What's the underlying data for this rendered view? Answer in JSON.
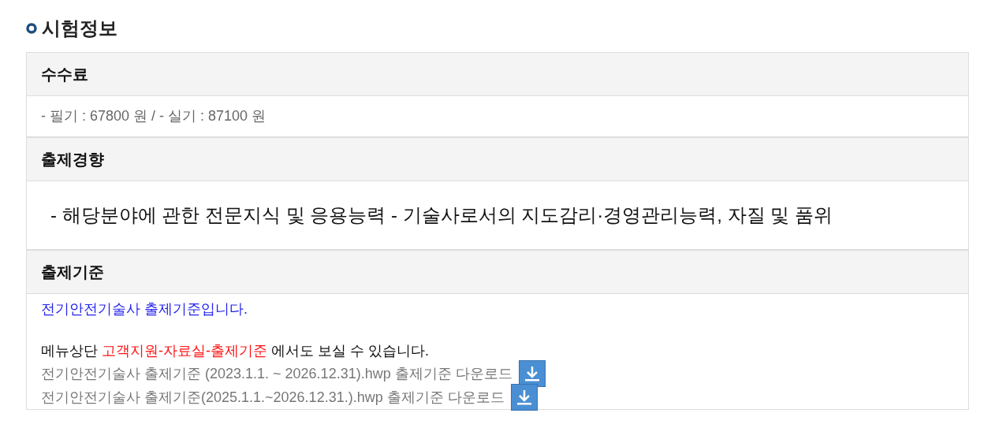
{
  "title": "시험정보",
  "sections": [
    {
      "heading": "수수료",
      "kind": "plain",
      "text": "- 필기 : 67800 원 / - 실기 : 87100 원"
    },
    {
      "heading": "출제경향",
      "kind": "large",
      "text": "- 해당분야에 관한 전문지식 및 응용능력 - 기술사로서의 지도감리·경영관리능력, 자질 및 품위"
    },
    {
      "heading": "출제기준",
      "kind": "standards",
      "intro": "전기안전기술사 출제기준입니다.",
      "note": [
        {
          "text": "메뉴상단 ",
          "highlight": false
        },
        {
          "text": "고객지원-자료실-출제기준",
          "highlight": true
        },
        {
          "text": " 에서도 보실 수 있습니다.",
          "highlight": false
        }
      ],
      "downloads": [
        "전기안전기술사 출제기준 (2023.1.1. ~ 2026.12.31).hwp 출제기준 다운로드",
        "전기안전기술사 출제기준(2025.1.1.~2026.12.31.).hwp 출제기준 다운로드"
      ]
    }
  ]
}
